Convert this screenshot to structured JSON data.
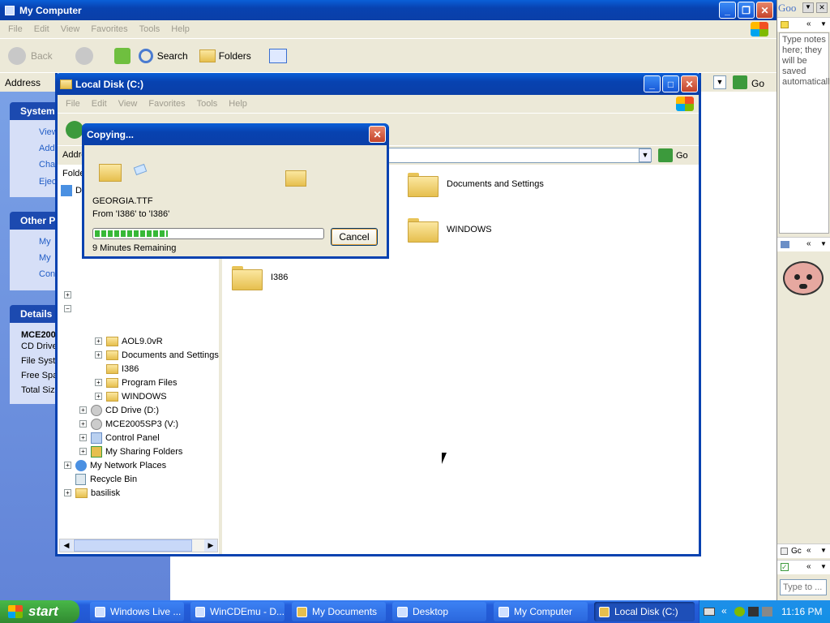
{
  "outer_window": {
    "title": "My Computer",
    "menu": [
      "File",
      "Edit",
      "View",
      "Favorites",
      "Tools",
      "Help"
    ],
    "toolbar": {
      "back": "Back",
      "search": "Search",
      "folders": "Folders"
    },
    "address_label": "Address",
    "go_label": "Go",
    "panels": {
      "system_tasks": {
        "title": "System",
        "items": [
          "View",
          "Add",
          "Cha",
          "Eject"
        ]
      },
      "other_places": {
        "title": "Other P",
        "items": [
          "My",
          "My",
          "Con"
        ]
      },
      "details": {
        "title": "Details",
        "name": "MCE200",
        "lines": [
          "CD Drive",
          "File Syst",
          "Free Spa",
          "Total Siz"
        ]
      }
    }
  },
  "inner_window": {
    "title": "Local Disk (C:)",
    "menu": [
      "File",
      "Edit",
      "View",
      "Favorites",
      "Tools",
      "Help"
    ],
    "address_label": "Addre",
    "go_label": "Go",
    "folders_label": "Folde",
    "tree": [
      {
        "label": "AOL9.0vR",
        "exp": "+"
      },
      {
        "label": "Documents and Settings",
        "exp": "+"
      },
      {
        "label": "I386",
        "exp": ""
      },
      {
        "label": "Program Files",
        "exp": "+"
      },
      {
        "label": "WINDOWS",
        "exp": "+"
      },
      {
        "label": "CD Drive (D:)",
        "exp": "+"
      },
      {
        "label": "MCE2005SP3 (V:)",
        "exp": "+"
      },
      {
        "label": "Control Panel",
        "exp": "+"
      },
      {
        "label": "My Sharing Folders",
        "exp": "+"
      },
      {
        "label": "My Network Places",
        "exp": "+"
      },
      {
        "label": "Recycle Bin",
        "exp": ""
      },
      {
        "label": "basilisk",
        "exp": "+"
      }
    ],
    "tree_top_letter": "D",
    "files": [
      "Documents and Settings",
      "WINDOWS",
      "I386"
    ]
  },
  "copy_dialog": {
    "title": "Copying...",
    "filename": "GEORGIA.TTF",
    "from_to": "From 'I386' to 'I386'",
    "remaining": "9 Minutes Remaining",
    "cancel": "Cancel",
    "progress": 0.32
  },
  "sidebar": {
    "notes_text": "Type notes here; they will be saved automatically.",
    "search_placeholder": "Type to ...",
    "google_label": "Goo",
    "gadget_label": "Gc"
  },
  "taskbar": {
    "start": "start",
    "buttons": [
      "Windows Live ...",
      "WinCDEmu - D...",
      "My Documents",
      "Desktop",
      "My Computer",
      "Local Disk (C:)"
    ],
    "active_index": 5,
    "clock": "11:16 PM"
  },
  "colors": {
    "accent": "#0842b0",
    "taskbar": "#245edb",
    "start": "#3c9a3c",
    "panel_bg": "#d6dff7"
  }
}
